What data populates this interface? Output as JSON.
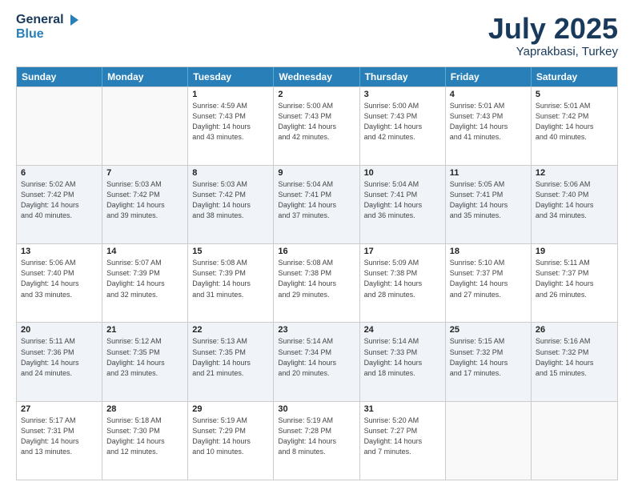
{
  "logo": {
    "line1": "General",
    "line2": "Blue"
  },
  "title": "July 2025",
  "location": "Yaprakbasi, Turkey",
  "days_of_week": [
    "Sunday",
    "Monday",
    "Tuesday",
    "Wednesday",
    "Thursday",
    "Friday",
    "Saturday"
  ],
  "weeks": [
    [
      {
        "day": "",
        "lines": []
      },
      {
        "day": "",
        "lines": []
      },
      {
        "day": "1",
        "lines": [
          "Sunrise: 4:59 AM",
          "Sunset: 7:43 PM",
          "Daylight: 14 hours",
          "and 43 minutes."
        ]
      },
      {
        "day": "2",
        "lines": [
          "Sunrise: 5:00 AM",
          "Sunset: 7:43 PM",
          "Daylight: 14 hours",
          "and 42 minutes."
        ]
      },
      {
        "day": "3",
        "lines": [
          "Sunrise: 5:00 AM",
          "Sunset: 7:43 PM",
          "Daylight: 14 hours",
          "and 42 minutes."
        ]
      },
      {
        "day": "4",
        "lines": [
          "Sunrise: 5:01 AM",
          "Sunset: 7:43 PM",
          "Daylight: 14 hours",
          "and 41 minutes."
        ]
      },
      {
        "day": "5",
        "lines": [
          "Sunrise: 5:01 AM",
          "Sunset: 7:42 PM",
          "Daylight: 14 hours",
          "and 40 minutes."
        ]
      }
    ],
    [
      {
        "day": "6",
        "lines": [
          "Sunrise: 5:02 AM",
          "Sunset: 7:42 PM",
          "Daylight: 14 hours",
          "and 40 minutes."
        ]
      },
      {
        "day": "7",
        "lines": [
          "Sunrise: 5:03 AM",
          "Sunset: 7:42 PM",
          "Daylight: 14 hours",
          "and 39 minutes."
        ]
      },
      {
        "day": "8",
        "lines": [
          "Sunrise: 5:03 AM",
          "Sunset: 7:42 PM",
          "Daylight: 14 hours",
          "and 38 minutes."
        ]
      },
      {
        "day": "9",
        "lines": [
          "Sunrise: 5:04 AM",
          "Sunset: 7:41 PM",
          "Daylight: 14 hours",
          "and 37 minutes."
        ]
      },
      {
        "day": "10",
        "lines": [
          "Sunrise: 5:04 AM",
          "Sunset: 7:41 PM",
          "Daylight: 14 hours",
          "and 36 minutes."
        ]
      },
      {
        "day": "11",
        "lines": [
          "Sunrise: 5:05 AM",
          "Sunset: 7:41 PM",
          "Daylight: 14 hours",
          "and 35 minutes."
        ]
      },
      {
        "day": "12",
        "lines": [
          "Sunrise: 5:06 AM",
          "Sunset: 7:40 PM",
          "Daylight: 14 hours",
          "and 34 minutes."
        ]
      }
    ],
    [
      {
        "day": "13",
        "lines": [
          "Sunrise: 5:06 AM",
          "Sunset: 7:40 PM",
          "Daylight: 14 hours",
          "and 33 minutes."
        ]
      },
      {
        "day": "14",
        "lines": [
          "Sunrise: 5:07 AM",
          "Sunset: 7:39 PM",
          "Daylight: 14 hours",
          "and 32 minutes."
        ]
      },
      {
        "day": "15",
        "lines": [
          "Sunrise: 5:08 AM",
          "Sunset: 7:39 PM",
          "Daylight: 14 hours",
          "and 31 minutes."
        ]
      },
      {
        "day": "16",
        "lines": [
          "Sunrise: 5:08 AM",
          "Sunset: 7:38 PM",
          "Daylight: 14 hours",
          "and 29 minutes."
        ]
      },
      {
        "day": "17",
        "lines": [
          "Sunrise: 5:09 AM",
          "Sunset: 7:38 PM",
          "Daylight: 14 hours",
          "and 28 minutes."
        ]
      },
      {
        "day": "18",
        "lines": [
          "Sunrise: 5:10 AM",
          "Sunset: 7:37 PM",
          "Daylight: 14 hours",
          "and 27 minutes."
        ]
      },
      {
        "day": "19",
        "lines": [
          "Sunrise: 5:11 AM",
          "Sunset: 7:37 PM",
          "Daylight: 14 hours",
          "and 26 minutes."
        ]
      }
    ],
    [
      {
        "day": "20",
        "lines": [
          "Sunrise: 5:11 AM",
          "Sunset: 7:36 PM",
          "Daylight: 14 hours",
          "and 24 minutes."
        ]
      },
      {
        "day": "21",
        "lines": [
          "Sunrise: 5:12 AM",
          "Sunset: 7:35 PM",
          "Daylight: 14 hours",
          "and 23 minutes."
        ]
      },
      {
        "day": "22",
        "lines": [
          "Sunrise: 5:13 AM",
          "Sunset: 7:35 PM",
          "Daylight: 14 hours",
          "and 21 minutes."
        ]
      },
      {
        "day": "23",
        "lines": [
          "Sunrise: 5:14 AM",
          "Sunset: 7:34 PM",
          "Daylight: 14 hours",
          "and 20 minutes."
        ]
      },
      {
        "day": "24",
        "lines": [
          "Sunrise: 5:14 AM",
          "Sunset: 7:33 PM",
          "Daylight: 14 hours",
          "and 18 minutes."
        ]
      },
      {
        "day": "25",
        "lines": [
          "Sunrise: 5:15 AM",
          "Sunset: 7:32 PM",
          "Daylight: 14 hours",
          "and 17 minutes."
        ]
      },
      {
        "day": "26",
        "lines": [
          "Sunrise: 5:16 AM",
          "Sunset: 7:32 PM",
          "Daylight: 14 hours",
          "and 15 minutes."
        ]
      }
    ],
    [
      {
        "day": "27",
        "lines": [
          "Sunrise: 5:17 AM",
          "Sunset: 7:31 PM",
          "Daylight: 14 hours",
          "and 13 minutes."
        ]
      },
      {
        "day": "28",
        "lines": [
          "Sunrise: 5:18 AM",
          "Sunset: 7:30 PM",
          "Daylight: 14 hours",
          "and 12 minutes."
        ]
      },
      {
        "day": "29",
        "lines": [
          "Sunrise: 5:19 AM",
          "Sunset: 7:29 PM",
          "Daylight: 14 hours",
          "and 10 minutes."
        ]
      },
      {
        "day": "30",
        "lines": [
          "Sunrise: 5:19 AM",
          "Sunset: 7:28 PM",
          "Daylight: 14 hours",
          "and 8 minutes."
        ]
      },
      {
        "day": "31",
        "lines": [
          "Sunrise: 5:20 AM",
          "Sunset: 7:27 PM",
          "Daylight: 14 hours",
          "and 7 minutes."
        ]
      },
      {
        "day": "",
        "lines": []
      },
      {
        "day": "",
        "lines": []
      }
    ]
  ]
}
